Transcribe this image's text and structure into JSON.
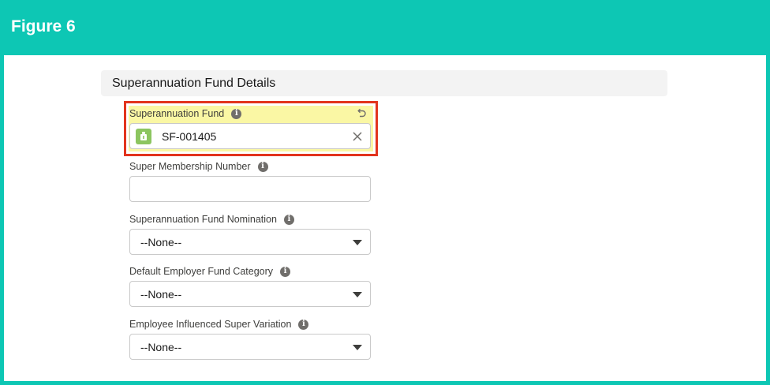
{
  "figure": {
    "title": "Figure 6"
  },
  "section": {
    "title": "Superannuation Fund Details"
  },
  "fields": {
    "superannuation_fund": {
      "label": "Superannuation Fund",
      "value": "SF-001405"
    },
    "super_membership_number": {
      "label": "Super Membership Number",
      "value": ""
    },
    "superannuation_fund_nomination": {
      "label": "Superannuation Fund Nomination",
      "selected": "--None--"
    },
    "default_employer_fund_category": {
      "label": "Default Employer Fund Category",
      "selected": "--None--"
    },
    "employee_influenced_super_variation": {
      "label": "Employee Influenced Super Variation",
      "selected": "--None--"
    }
  },
  "icons": {
    "info": "info-icon",
    "undo": "undo-icon",
    "record": "superannuation-fund-record-icon",
    "clear": "close-icon",
    "caret": "chevron-down-icon"
  },
  "colors": {
    "brand_teal": "#0dc7b4",
    "highlight_border": "#e2341d",
    "edited_field_background": "#faf7a4",
    "record_icon_green": "#8cc560",
    "section_header_background": "#f3f3f3"
  }
}
